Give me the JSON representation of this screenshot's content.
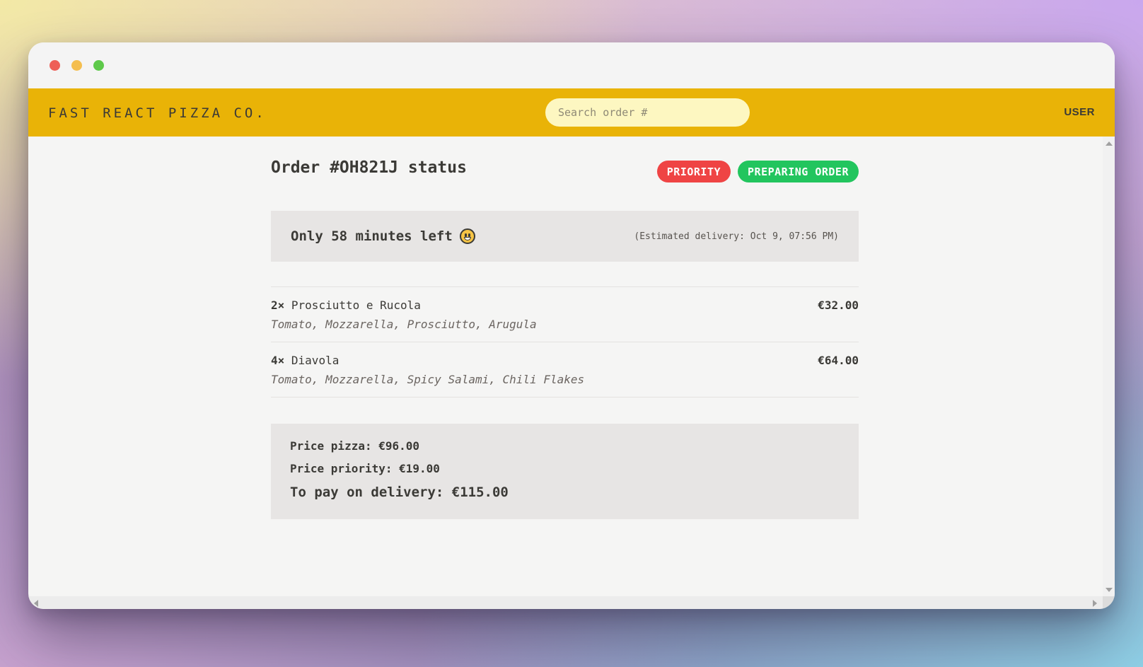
{
  "header": {
    "logo": "Fast React Pizza Co.",
    "search_placeholder": "Search order #",
    "user": "USER"
  },
  "order": {
    "title": "Order #OH821J status",
    "badges": {
      "priority": "Priority",
      "status": "Preparing order"
    },
    "eta_text": "Only 58 minutes left",
    "eta_emoji": "grinning-face-icon",
    "estimated": "(Estimated delivery: Oct 9, 07:56 PM)"
  },
  "items": [
    {
      "qty": "2×",
      "name": "Prosciutto e Rucola",
      "price": "€32.00",
      "ingredients": "Tomato, Mozzarella, Prosciutto, Arugula"
    },
    {
      "qty": "4×",
      "name": "Diavola",
      "price": "€64.00",
      "ingredients": "Tomato, Mozzarella, Spicy Salami, Chili Flakes"
    }
  ],
  "totals": {
    "pizza": "Price pizza: €96.00",
    "priority": "Price priority: €19.00",
    "to_pay": "To pay on delivery: €115.00"
  },
  "colors": {
    "header": "#e9b307",
    "priority_badge": "#ef4444",
    "status_badge": "#22c55e",
    "panel": "#e7e5e4"
  }
}
